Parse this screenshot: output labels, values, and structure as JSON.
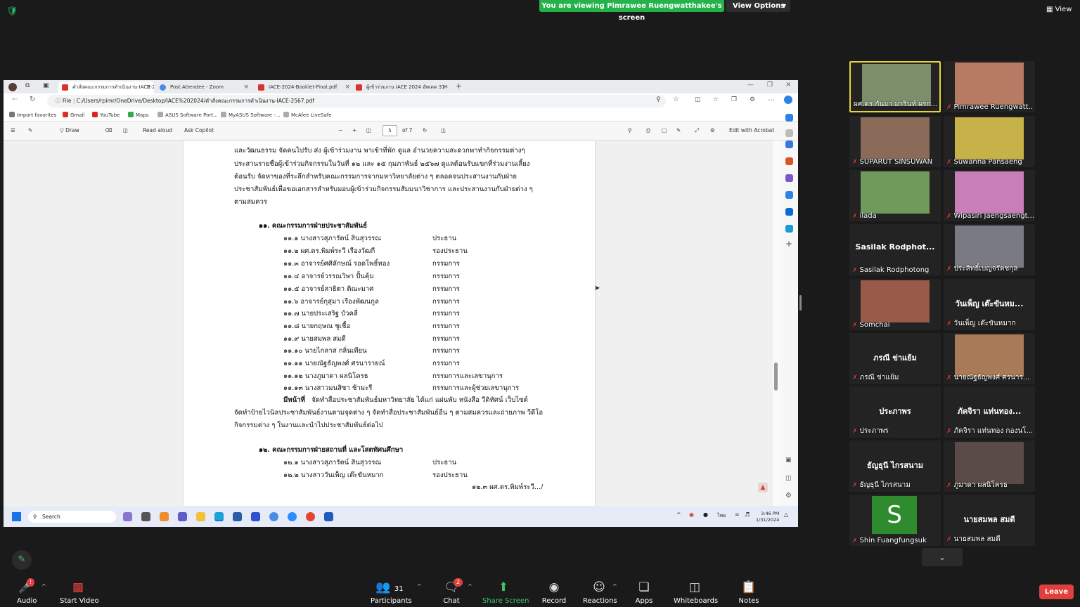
{
  "zoom_top": {
    "viewing_banner": "You are viewing Pimrawee Ruengwatthakee's screen",
    "view_options": "View Options",
    "view_button": "View"
  },
  "browser": {
    "tabs": [
      {
        "label": "คำสั่งคณะกรรมการดำเนินงาน-IACE-2",
        "color": "#d9342b"
      },
      {
        "label": "Post Attendee - Zoom",
        "color": "#4a8be8"
      },
      {
        "label": "IACE-2024-Booklet-Final.pdf",
        "color": "#d9342b"
      },
      {
        "label": "ผู้เข้าร่วมงาน IACE 2024 อัพเดต 31 -",
        "color": "#d9342b"
      }
    ],
    "url_prefix": "File",
    "url": "C:/Users/rpimr/OneDrive/Desktop/IACE%202024/คำสั่งคณะกรรมการดำเนินงาน-IACE-2567.pdf",
    "favorites": [
      "Import favorites",
      "Gmail",
      "YouTube",
      "Maps",
      "ASUS Software Port...",
      "MyASUS Software -...",
      "McAfee LiveSafe"
    ]
  },
  "pdf_toolbar": {
    "draw": "Draw",
    "read_aloud": "Read aloud",
    "ask_copilot": "Ask Copilot",
    "page_current": "5",
    "page_total": "of 7",
    "edit_acrobat": "Edit with Acrobat"
  },
  "document": {
    "intro_lines": [
      "และวัฒนธรรม จัดคนไปรับ ส่ง ผู้เข้าร่วมงาน พาเข้าที่พัก ดูแล อำนวยความสะดวกพาทำกิจกรรมต่างๆ",
      "ประสานรายชื่อผู้เข้าร่วมกิจกรรมในวันที่ ๑๒ และ ๑๕ กุมภาพันธ์ ๒๕๖๗ ดูแลต้อนรับแขกที่ร่วมงานเลี้ยง",
      "ต้อนรับ จัดหาของที่ระลึกสำหรับคณะกรรมการจากมหาวิทยาลัยต่าง ๆ ตลอดจนประสานงานกับฝ่าย",
      "ประชาสัมพันธ์เพื่อขอเอกสารสำหรับมอบผู้เข้าร่วมกิจกรรมสัมมนาวิชาการ และประสานงานกับฝ่ายต่าง ๆ",
      "ตามสมควร"
    ],
    "section11_title": "๑๑. คณะกรรมการฝ่ายประชาสัมพันธ์",
    "section11_members": [
      {
        "name": "๑๑.๑ นางสาวสุภารัตน์ สินสุวรรณ",
        "role": "ประธาน"
      },
      {
        "name": "๑๑.๒ ผศ.ดร.พิมพ์ระวี เรืองวัฒกี",
        "role": "รองประธาน"
      },
      {
        "name": "๑๑.๓ อาจารย์ศศิลักษณ์  รอดโพธิ์ทอง",
        "role": "กรรมการ"
      },
      {
        "name": "๑๑.๔ อาจารย์วรรณวิษา  ปั้นคุ้ม",
        "role": "กรรมการ"
      },
      {
        "name": "๑๑.๕ อาจารย์สาธิตา  ติณะมาศ",
        "role": "กรรมการ"
      },
      {
        "name": "๑๑.๖ อาจารย์กุสุมา  เรืองพัฒนกูล",
        "role": "กรรมการ"
      },
      {
        "name": "๑๑.๗ นายประเสริฐ  บัวคลี่",
        "role": "กรรมการ"
      },
      {
        "name": "๑๑.๘ นายกฤษณ  ชูเชื้อ",
        "role": "กรรมการ"
      },
      {
        "name": "๑๑.๙ นายสมพล  สมดี",
        "role": "กรรมการ"
      },
      {
        "name": "๑๑.๑๐ นายไกลาส  กลิ่นเทียน",
        "role": "กรรมการ"
      },
      {
        "name": "๑๑.๑๑ นายณัฐธัญพงศ์  ศรนารายณ์",
        "role": "กรรมการ"
      },
      {
        "name": "๑๑.๑๒ นางภูมาดา  ผลนิโครธ",
        "role": "กรรมการและเลขานุการ"
      },
      {
        "name": "๑๑.๑๓ นางสาวมนสิชา  ช้ามะรี",
        "role": "กรรมการและผู้ช่วยเลขานุการ"
      }
    ],
    "duty_label": "มีหน้าที่",
    "duty_line1": "จัดทำสื่อประชาสัมพันธ์มหาวิทยาลัย ได้แก่ แผ่นพับ หนังสือ วีดิทัศน์ เว็บไซต์",
    "duty_line2": "จัดทำป้ายไวนิลประชาสัมพันธ์งานตามจุดต่าง ๆ จัดทำสื่อประชาสัมพันธ์อื่น ๆ ตามสมควรและถ่ายภาพ วีดีโอ",
    "duty_line3": "กิจกรรมต่าง ๆ ในงานและนำไปประชาสัมพันธ์ต่อไป",
    "section12_title": "๑๒. คณะกรรมการฝ่ายสถานที่ และโสตทัศนศึกษา",
    "section12_members": [
      {
        "name": "๑๒.๑ นางสาวสุภารัตน์ สินสุวรรณ",
        "role": "ประธาน"
      },
      {
        "name": "๑๒.๒ นางสาววันเพ็ญ  เต๊ะขันหมาก",
        "role": "รองประธาน"
      }
    ],
    "next_page_hint": "๑๒.๓ ผศ.ดร.พิมพ์ระวี.../"
  },
  "taskbar": {
    "search": "Search",
    "lang": "ไทย",
    "time": "3:46 PM",
    "date": "1/31/2024"
  },
  "participants": [
    {
      "name": "ผศ.ดร.กันยา มารินท์  ผรก...",
      "speaking": true,
      "muted": false,
      "photo": "#7c8f6a"
    },
    {
      "name": "Pimrawee Ruengwatt...",
      "speaking": false,
      "muted": true,
      "photo": "#b77a62"
    },
    {
      "name": "SUPARUT SINSUWAN",
      "speaking": false,
      "muted": true,
      "photo": "#8a6b5a"
    },
    {
      "name": "Suwanna Pansaeng",
      "speaking": false,
      "muted": true,
      "photo": "#c7b24a"
    },
    {
      "name": "ilada",
      "speaking": false,
      "muted": true,
      "photo": "#6f9a5c"
    },
    {
      "name": "Wipasiri Jaengsaengt...",
      "speaking": false,
      "muted": true,
      "photo": "#c87fb8"
    },
    {
      "name": "Sasilak Rodphotong",
      "speaking": false,
      "muted": true,
      "center": "Sasilak  Rodphot..."
    },
    {
      "name": "ประสิทธิ์เบญจรัตชกุล",
      "speaking": false,
      "muted": true,
      "photo": "#7a7a84"
    },
    {
      "name": "Somchai",
      "speaking": false,
      "muted": true,
      "photo": "#9a5a4a"
    },
    {
      "name": "วันเพ็ญ เต๊ะขันหมาก",
      "speaking": false,
      "muted": true,
      "center": "วันเพ็ญ เต๊ะขันหม..."
    },
    {
      "name": "ภรณี ข่าแย้ม",
      "speaking": false,
      "muted": true,
      "center": "ภรณี ข่าแย้ม"
    },
    {
      "name": "นายณัฐธัญพงศ์ ศรนาร...",
      "speaking": false,
      "muted": true,
      "photo": "#a87a58"
    },
    {
      "name": "ประภาพร",
      "speaking": false,
      "muted": true,
      "center": "ประภาพร"
    },
    {
      "name": "ภัคจิรา แท่นทอง กองนโ...",
      "speaking": false,
      "muted": true,
      "center": "ภัคจิรา แท่นทอง..."
    },
    {
      "name": "ธัญธุนี  ไกรสนาม",
      "speaking": false,
      "muted": true,
      "center": "ธัญธุนี  ไกรสนาม"
    },
    {
      "name": "ภูมาดา ผลนิโครธ",
      "speaking": false,
      "muted": true,
      "photo": "#5a4a48"
    },
    {
      "name": "Shin Fuangfungsuk",
      "speaking": false,
      "muted": true,
      "avatar_letter": "S",
      "avatar_color": "#2e8b2e"
    },
    {
      "name": "นายสมพล  สมดี",
      "speaking": false,
      "muted": true,
      "center": "นายสมพล  สมดี"
    }
  ],
  "controls": {
    "audio": "Audio",
    "start_video": "Start Video",
    "participants": "Participants",
    "participants_count": "31",
    "chat": "Chat",
    "chat_badge": "2",
    "share_screen": "Share Screen",
    "record": "Record",
    "reactions": "Reactions",
    "apps": "Apps",
    "whiteboards": "Whiteboards",
    "notes": "Notes",
    "leave": "Leave",
    "audio_badge": "!"
  },
  "colors": {
    "banner_green": "#24b24a",
    "leave_red": "#e0403d",
    "speaking_border": "#e5d53b",
    "share_green": "#3fc36a"
  }
}
